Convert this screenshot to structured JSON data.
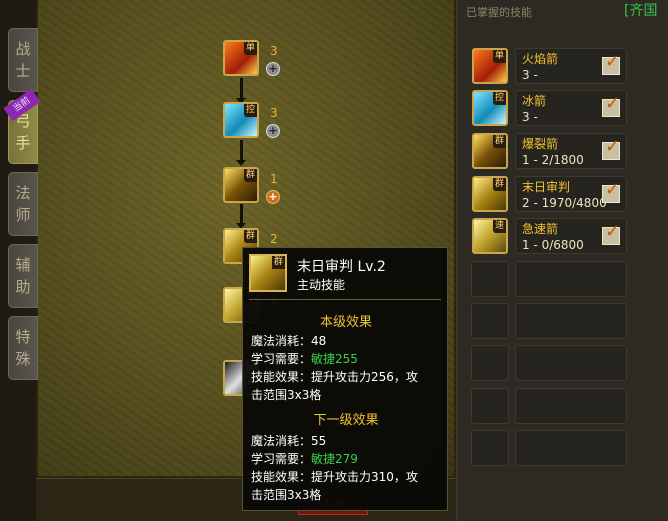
{
  "panel": {
    "title": "已掌握的技能",
    "faction": "[齐国"
  },
  "tabs": [
    {
      "label": "战士"
    },
    {
      "label": "弓手",
      "badge": "当前"
    },
    {
      "label": "法师"
    },
    {
      "label": "辅助"
    },
    {
      "label": "特殊"
    }
  ],
  "tree": [
    {
      "icon": "fire-arrow-icon",
      "glyph": "单",
      "level": "3"
    },
    {
      "icon": "ice-arrow-icon",
      "glyph": "控",
      "level": "3"
    },
    {
      "icon": "burst-arrow-icon",
      "glyph": "群",
      "level": "1"
    },
    {
      "icon": "doom-judgment-icon",
      "glyph": "群",
      "level": "2"
    },
    {
      "icon": "rapid-arrow-icon",
      "glyph": "速",
      "level": "1"
    },
    {
      "icon": "dark-skill-icon",
      "glyph": "",
      "level": ""
    }
  ],
  "learned": [
    {
      "name": "火焰箭",
      "detail": "3 -",
      "glyph": "单",
      "checked": true
    },
    {
      "name": "冰箭",
      "detail": "3 -",
      "glyph": "控",
      "checked": true
    },
    {
      "name": "爆裂箭",
      "detail": "1 - 2/1800",
      "glyph": "群",
      "checked": true
    },
    {
      "name": "末日审判",
      "detail": "2 - 1970/4800",
      "glyph": "群",
      "checked": true
    },
    {
      "name": "急速箭",
      "detail": "1 - 0/6800",
      "glyph": "速",
      "checked": true
    }
  ],
  "tooltip": {
    "name": "末日审判 Lv.2",
    "type": "主动技能",
    "glyph": "群",
    "current_header": "本级效果",
    "cur_mp_label": "魔法消耗：",
    "cur_mp": "48",
    "cur_req_label": "学习需要：",
    "cur_req": "敏捷255",
    "cur_effect_label": "技能效果：",
    "cur_effect_1": "提升攻击力256，攻",
    "cur_effect_2": "击范围3x3格",
    "next_header": "下一级效果",
    "next_mp_label": "魔法消耗：",
    "next_mp": "55",
    "next_req_label": "学习需要：",
    "next_req": "敏捷279",
    "next_effect_label": "技能效果：",
    "next_effect_1": "提升攻击力310，攻",
    "next_effect_2": "击范围3x3格"
  },
  "bottom": {
    "char_button": "人物"
  }
}
